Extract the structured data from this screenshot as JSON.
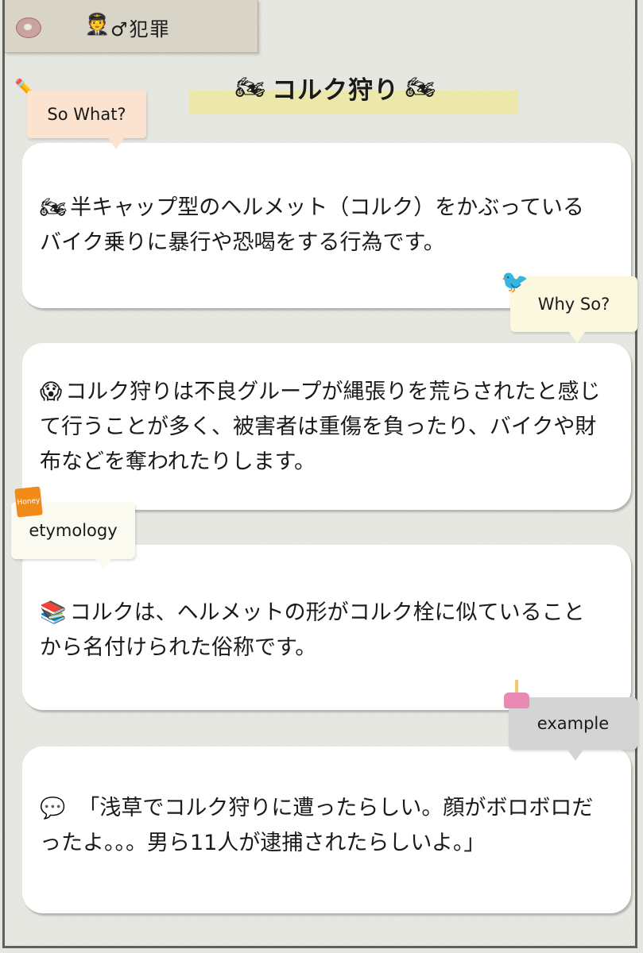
{
  "header": {
    "tag_icon": "🧑‍✈️",
    "tag_text": "♂犯罪"
  },
  "title": {
    "text": "コルク狩り",
    "icon_left": "🏍",
    "icon_right": "🏍"
  },
  "sections": [
    {
      "label": "So What?",
      "label_color": "#fbe3cf",
      "deco_icon": "pencil-icon",
      "lead_icon": "🏍",
      "text": "半キャップ型のヘルメット（コルク）をかぶっているバイク乗りに暴行や恐喝をする行為です。"
    },
    {
      "label": "Why So?",
      "label_color": "#fbf8df",
      "deco_icon": "bird-icon",
      "lead_icon": "😱",
      "text": "コルク狩りは不良グループが縄張りを荒らされたと感じて行うことが多く、被害者は重傷を負ったり、バイクや財布などを奪われたりします。"
    },
    {
      "label": "etymology",
      "label_color": "#fbfaf0",
      "deco_icon": "honey-jar-icon",
      "deco_text": "Honey",
      "lead_icon": "📚",
      "text": "コルクは、ヘルメットの形がコルク栓に似ていることから名付けられた俗称です。"
    },
    {
      "label": "example",
      "label_color": "#d4d4d4",
      "deco_icon": "cake-icon",
      "lead_icon": "💬",
      "text": "「浅草でコルク狩りに遭ったらしい。顔がボロボロだったよ。。。男ら11人が逮捕されたらしいよ。」"
    }
  ]
}
